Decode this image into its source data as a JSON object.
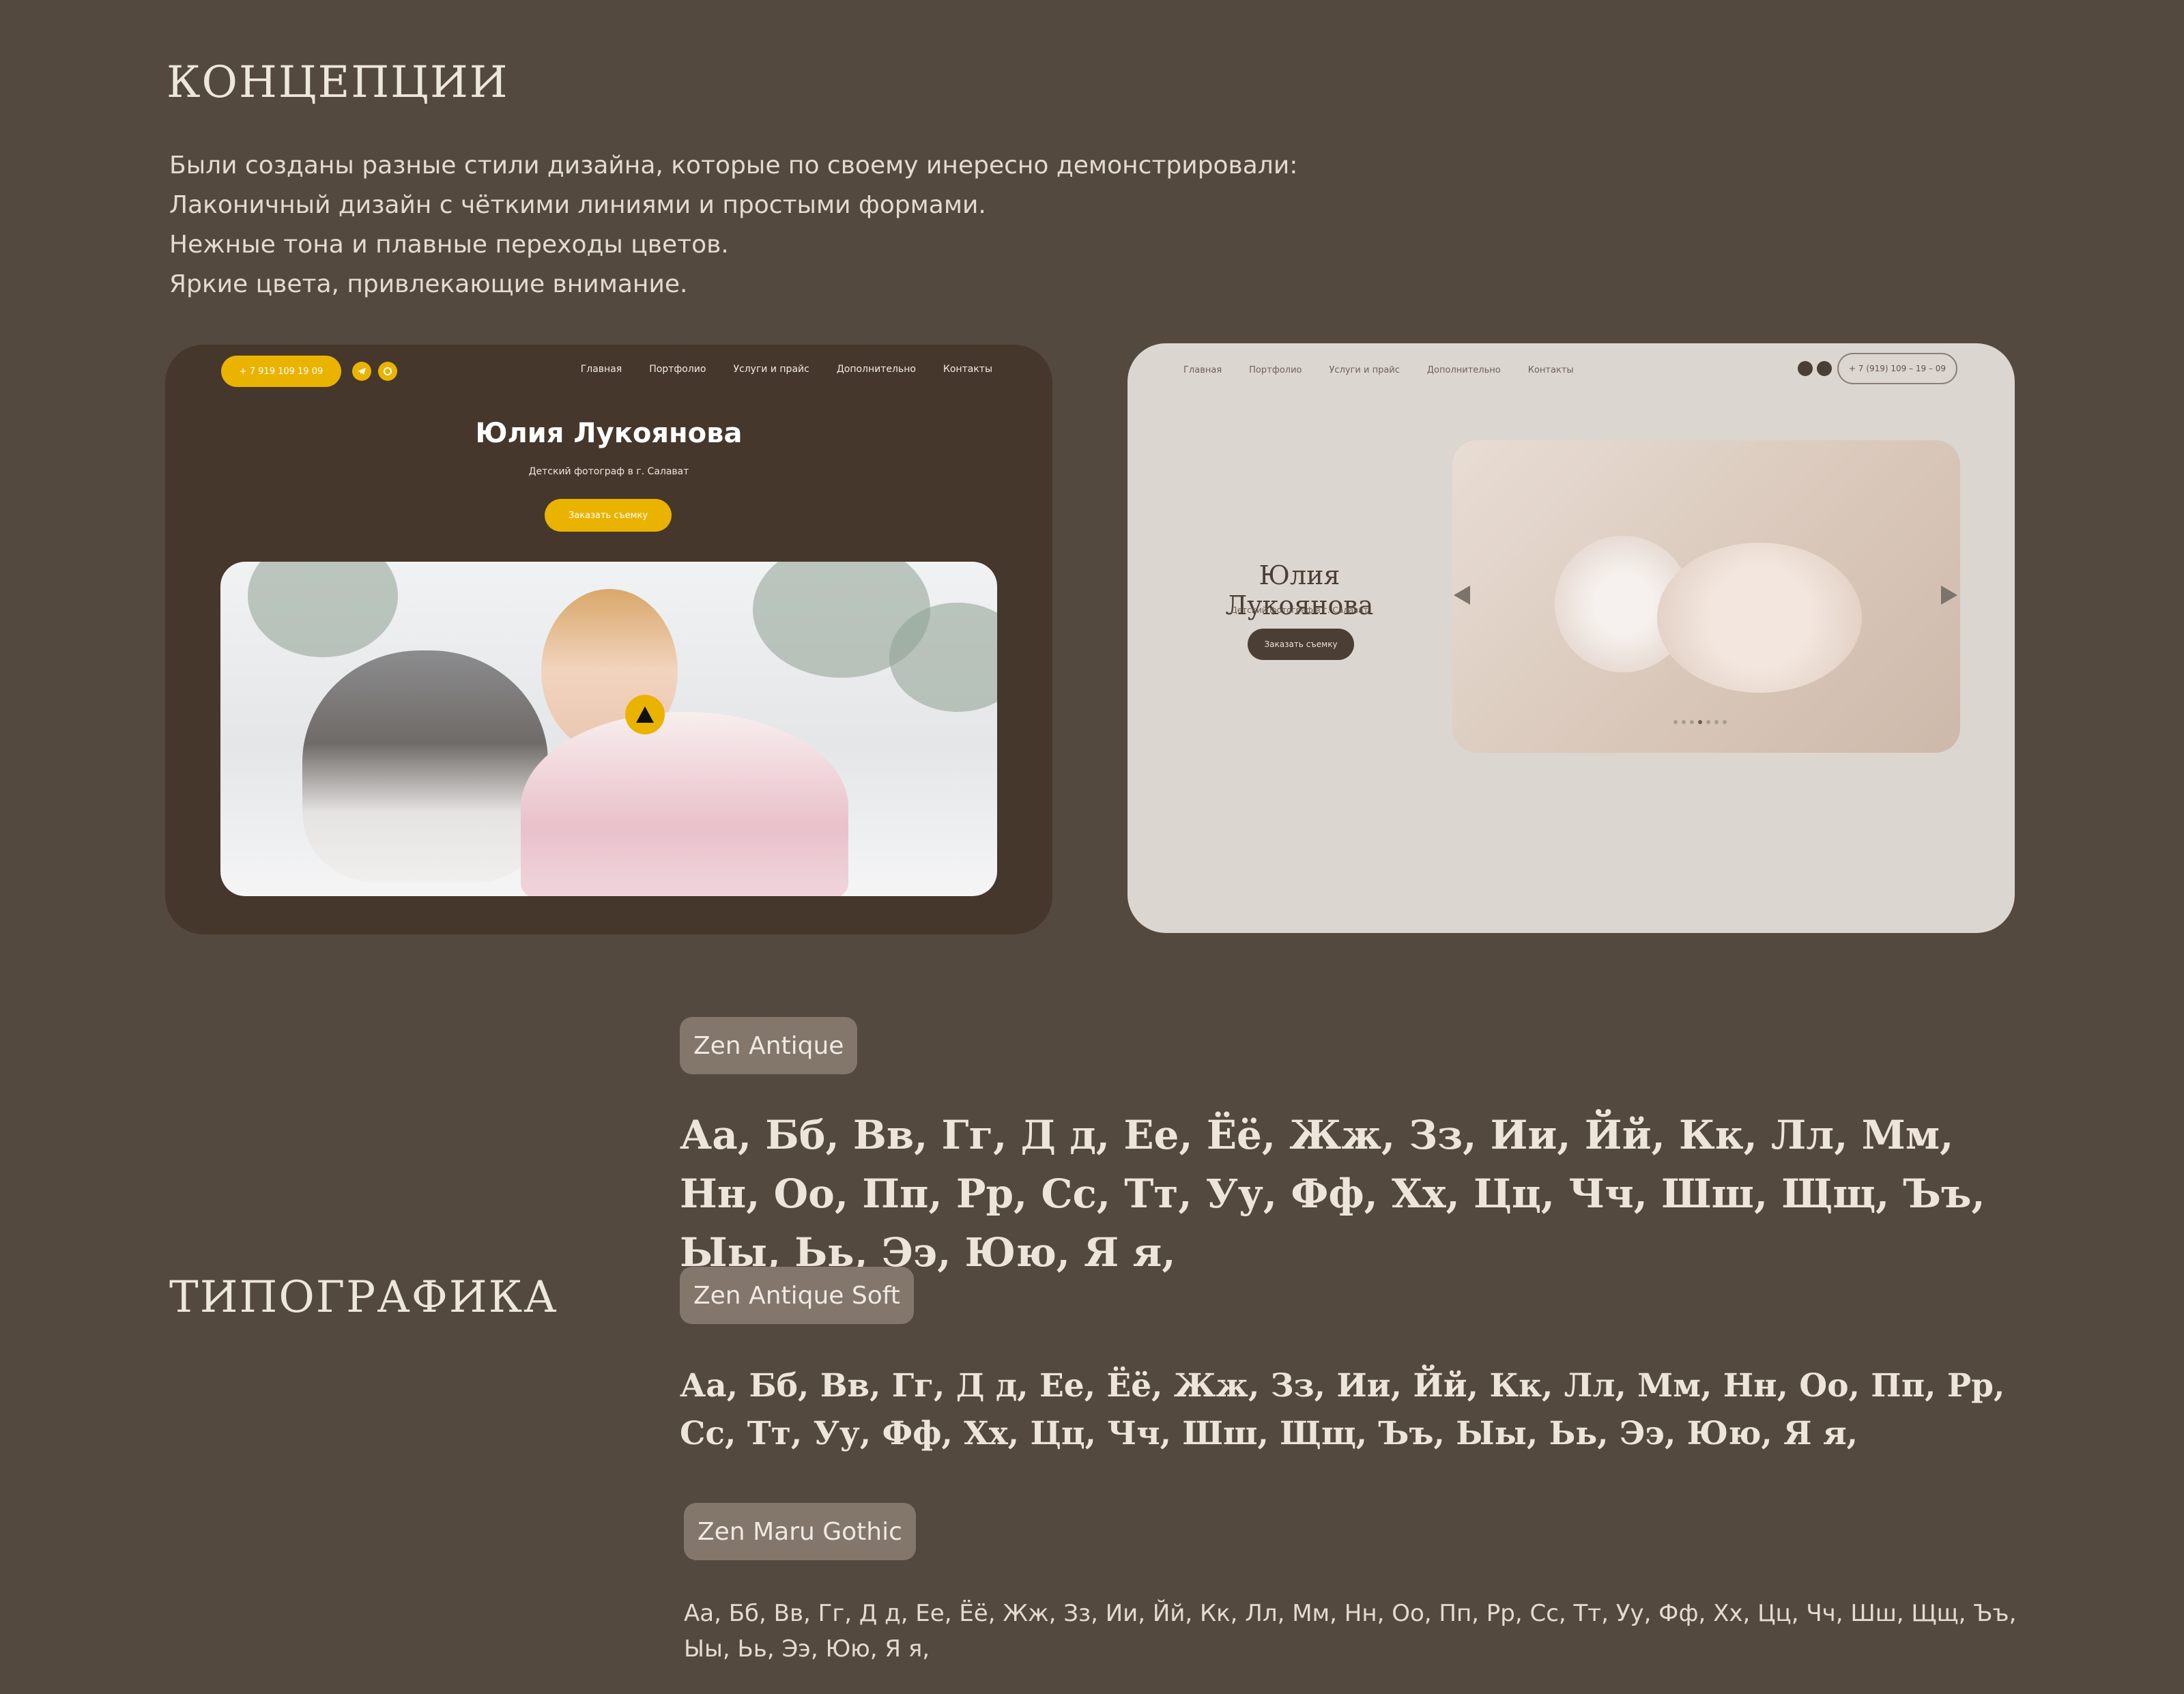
{
  "concepts": {
    "title": "КОНЦЕПЦИИ",
    "lines": [
      "Были созданы разные стили дизайна, которые по своему инересно демонстрировали:",
      "Лаконичный дизайн с чёткими линиями и простыми формами.",
      "Нежные тона и плавные переходы цветов.",
      "Яркие цвета, привлекающие внимание."
    ]
  },
  "mock_dark": {
    "phone": "+ 7 919 109 19 09",
    "nav": [
      "Главная",
      "Портфолио",
      "Услуги и прайс",
      "Дополнительно",
      "Контакты"
    ],
    "name": "Юлия Лукоянова",
    "subtitle": "Детский фотограф в г. Салават",
    "cta": "Заказать съемку",
    "accent": "#E9B300",
    "bg": "#46372C"
  },
  "mock_light": {
    "nav": [
      "Главная",
      "Портфолио",
      "Услуги и прайс",
      "Дополнительно",
      "Контакты"
    ],
    "phone": "+ 7 (919) 109 – 19 – 09",
    "name": "Юлия Лукоянова",
    "subtitle": "Детский фотограф в г. Салават",
    "cta": "Заказать съемку",
    "bg": "#DCD6D0",
    "accent": "#4B3F35"
  },
  "typography": {
    "title": "ТИПОГРАФИКА",
    "fonts": [
      {
        "name": "Zen Antique",
        "sample": "Аа, Бб, Вв, Гг, Д д, Ее, Ёё, Жж, Зз, Ии, Йй, Кк, Лл, Мм, Нн, Оо, Пп, Рр, Сс, Тт, Уу, Фф, Хх, Цц, Чч, Шш, Щщ, Ъъ, Ыы, Ьь, Ээ, Юю, Я я,"
      },
      {
        "name": "Zen Antique Soft",
        "sample": "Аа, Бб, Вв, Гг, Д д, Ее, Ёё, Жж, Зз, Ии, Йй, Кк, Лл, Мм, Нн, Оо, Пп, Рр, Сс, Тт, Уу, Фф, Хх, Цц, Чч, Шш, Щщ, Ъъ, Ыы, Ьь, Ээ, Юю, Я я,"
      },
      {
        "name": "Zen Maru Gothic",
        "sample": "Аа, Бб, Вв, Гг, Д д, Ее, Ёё, Жж, Зз, Ии, Йй, Кк, Лл, Мм, Нн, Оо, Пп, Рр, Сс, Тт, Уу, Фф, Хх, Цц, Чч, Шш, Щщ, Ъъ, Ыы, Ьь, Ээ, Юю, Я я,"
      }
    ]
  },
  "colors": {
    "page_bg": "#54493E",
    "tag_bg": "#83776C"
  }
}
